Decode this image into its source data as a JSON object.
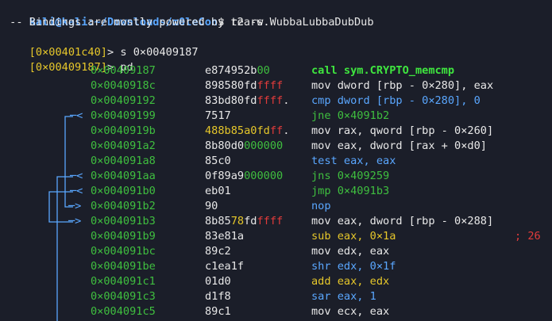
{
  "terminal": {
    "prompt": {
      "user_host": "kali@kali",
      "path": ":~/Downloads/m0leCon",
      "suffix": "$ ",
      "command": "r2 -w WubbaLubbaDubDub"
    },
    "banner": " -- Bindings are mostly powered by tears.",
    "commands": [
      {
        "addr": "[0×00401c40]",
        "gt": "> ",
        "cmd": "s 0×00409187"
      },
      {
        "addr": "[0×00409187]",
        "gt": "> ",
        "cmd": "pd"
      }
    ],
    "colors": {
      "background": "#1b1e29",
      "address": "#3fbf3f",
      "flow_arrow": "#5aa7ff",
      "prompt_addr": "#e6c72a",
      "byte_green": "#3fbf3f",
      "byte_red": "#e03b3b",
      "byte_yellow": "#e6c72a",
      "byte_white": "#e8e8e8"
    },
    "disasm": [
      {
        "addr": "0×00409187",
        "arrow": "",
        "bytes": [
          [
            "e874952b",
            "#e8e8e8"
          ],
          [
            "00",
            "#3fbf3f"
          ]
        ],
        "ops": [
          [
            "call sym.CRYPTO_memcmp",
            "#3fe63f"
          ]
        ]
      },
      {
        "addr": "0×0040918c",
        "arrow": "",
        "bytes": [
          [
            "898580fd",
            "#e8e8e8"
          ],
          [
            "ffff",
            "#e03b3b"
          ]
        ],
        "ops": [
          [
            "mov dword [rbp - 0×280], eax",
            "#e8e8e8"
          ]
        ]
      },
      {
        "addr": "0×00409192",
        "arrow": "",
        "bytes": [
          [
            "83bd80fd",
            "#e8e8e8"
          ],
          [
            "ffff",
            "#e03b3b"
          ],
          [
            ".",
            "#e8e8e8"
          ]
        ],
        "ops": [
          [
            "cmp dword [rbp - 0×280], 0",
            "#5aa7ff"
          ]
        ]
      },
      {
        "addr": "0×00409199",
        "arrow": "─< ",
        "bytes": [
          [
            "7517",
            "#e8e8e8"
          ]
        ],
        "ops": [
          [
            "jne 0×4091b2",
            "#3fbf3f"
          ]
        ]
      },
      {
        "addr": "0×0040919b",
        "arrow": "",
        "bytes": [
          [
            "488b85a0fd",
            "#e6c72a"
          ],
          [
            "ff",
            "#e03b3b"
          ],
          [
            ".",
            "#e8e8e8"
          ]
        ],
        "ops": [
          [
            "mov rax, qword [rbp - 0×260]",
            "#e8e8e8"
          ]
        ]
      },
      {
        "addr": "0×004091a2",
        "arrow": "",
        "bytes": [
          [
            "8b80d0",
            "#e8e8e8"
          ],
          [
            "000000",
            "#3fbf3f"
          ]
        ],
        "ops": [
          [
            "mov eax, dword [rax + 0×d0]",
            "#e8e8e8"
          ]
        ]
      },
      {
        "addr": "0×004091a8",
        "arrow": "",
        "bytes": [
          [
            "85c0",
            "#e8e8e8"
          ]
        ],
        "ops": [
          [
            "test eax, eax",
            "#5aa7ff"
          ]
        ]
      },
      {
        "addr": "0×004091aa",
        "arrow": "─< ",
        "bytes": [
          [
            "0f89a9",
            "#e8e8e8"
          ],
          [
            "000000",
            "#3fbf3f"
          ]
        ],
        "ops": [
          [
            "jns 0×409259",
            "#3fbf3f"
          ]
        ]
      },
      {
        "addr": "0×004091b0",
        "arrow": "─< ",
        "bytes": [
          [
            "eb01",
            "#e8e8e8"
          ]
        ],
        "ops": [
          [
            "jmp 0×4091b3",
            "#3fbf3f"
          ]
        ]
      },
      {
        "addr": "0×004091b2",
        "arrow": "─> ",
        "bytes": [
          [
            "90",
            "#e8e8e8"
          ]
        ],
        "ops": [
          [
            "nop",
            "#5aa7ff"
          ]
        ]
      },
      {
        "addr": "0×004091b3",
        "arrow": "─> ",
        "bytes": [
          [
            "8b85",
            "#e8e8e8"
          ],
          [
            "78",
            "#e6c72a"
          ],
          [
            "fd",
            "#e8e8e8"
          ],
          [
            "ffff",
            "#e03b3b"
          ]
        ],
        "ops": [
          [
            "mov eax, dword [rbp - 0×288]",
            "#e8e8e8"
          ]
        ]
      },
      {
        "addr": "0×004091b9",
        "arrow": "",
        "bytes": [
          [
            "83e81a",
            "#e8e8e8"
          ]
        ],
        "ops": [
          [
            "sub eax, 0×1a",
            "#e6c72a"
          ]
        ],
        "comment": "; 26"
      },
      {
        "addr": "0×004091bc",
        "arrow": "",
        "bytes": [
          [
            "89c2",
            "#e8e8e8"
          ]
        ],
        "ops": [
          [
            "mov edx, eax",
            "#e8e8e8"
          ]
        ]
      },
      {
        "addr": "0×004091be",
        "arrow": "",
        "bytes": [
          [
            "c1ea1f",
            "#e8e8e8"
          ]
        ],
        "ops": [
          [
            "shr edx, 0×1f",
            "#5aa7ff"
          ]
        ]
      },
      {
        "addr": "0×004091c1",
        "arrow": "",
        "bytes": [
          [
            "01d0",
            "#e8e8e8"
          ]
        ],
        "ops": [
          [
            "add eax, edx",
            "#e6c72a"
          ]
        ]
      },
      {
        "addr": "0×004091c3",
        "arrow": "",
        "bytes": [
          [
            "d1f8",
            "#e8e8e8"
          ]
        ],
        "ops": [
          [
            "sar eax, 1",
            "#5aa7ff"
          ]
        ]
      },
      {
        "addr": "0×004091c5",
        "arrow": "",
        "bytes": [
          [
            "89c1",
            "#e8e8e8"
          ]
        ],
        "ops": [
          [
            "mov ecx, eax",
            "#e8e8e8"
          ]
        ]
      }
    ]
  }
}
